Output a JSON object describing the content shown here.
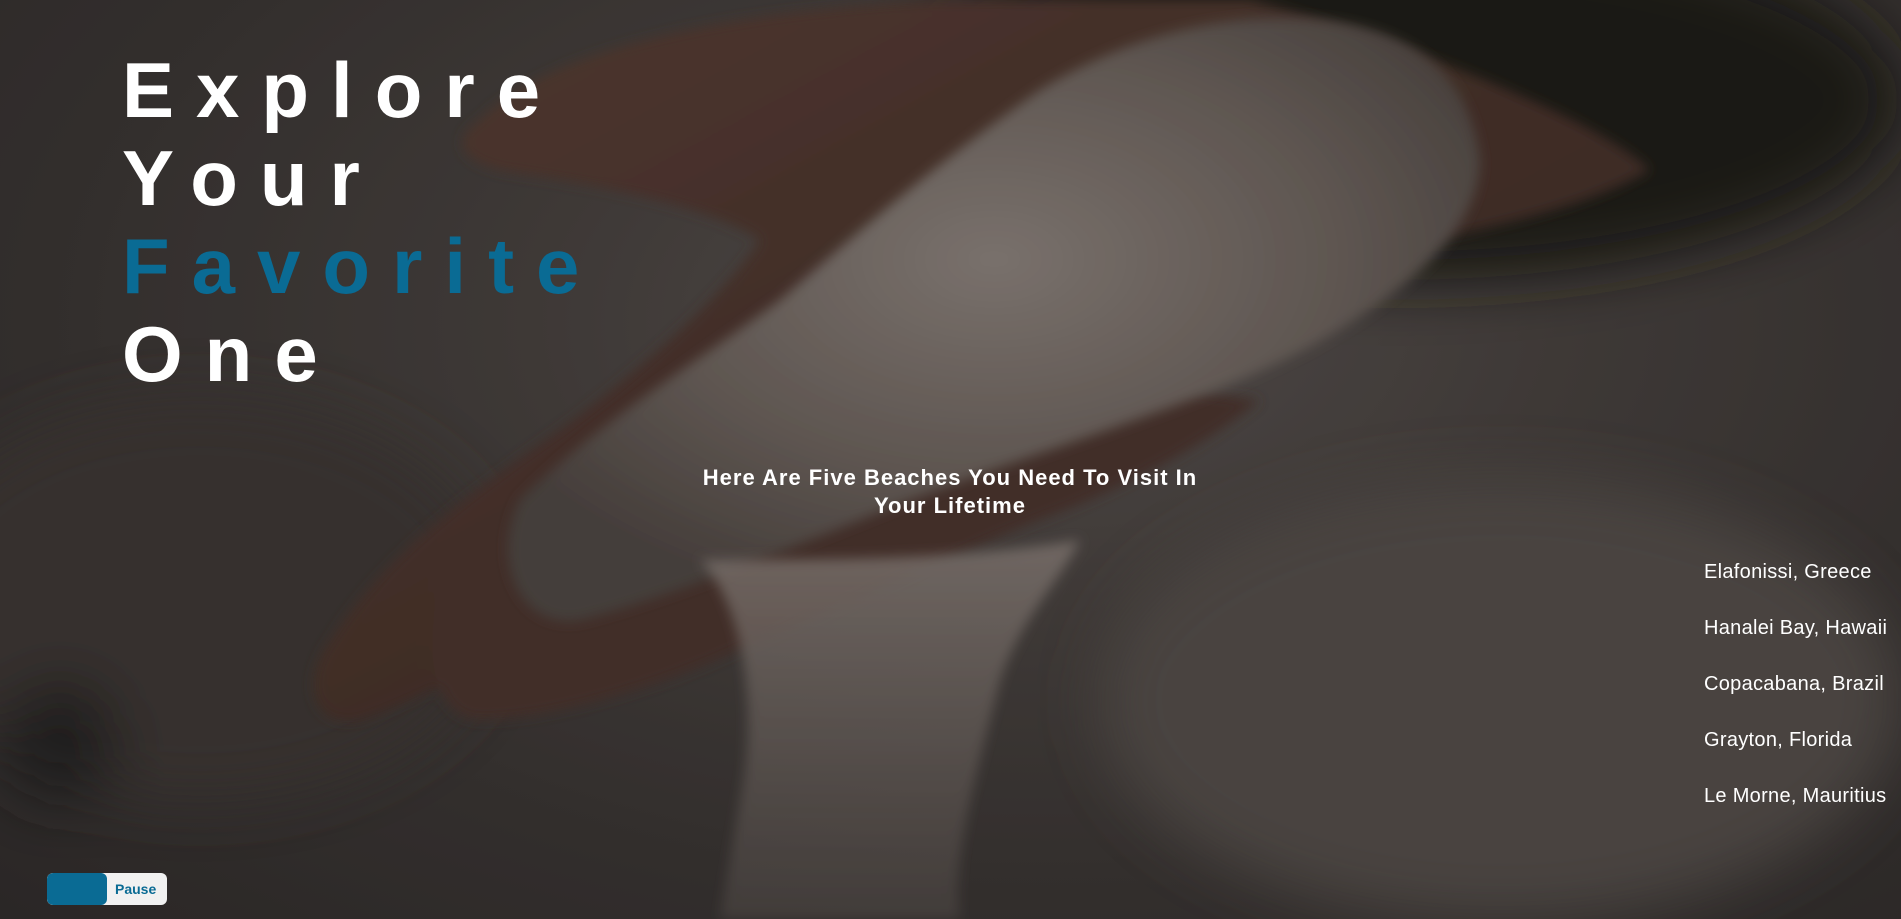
{
  "hero": {
    "headline_line1": "Explore",
    "headline_line2": "Your",
    "headline_line3": "Favorite",
    "headline_line4": "One",
    "subtitle": "Here Are Five Beaches You Need To Visit In Your Lifetime"
  },
  "beaches": [
    "Elafonissi, Greece",
    "Hanalei Bay, Hawaii",
    "Copacabana, Brazil",
    "Grayton, Florida",
    "Le Morne, Mauritius"
  ],
  "controls": {
    "pause_label": "Pause"
  },
  "colors": {
    "accent": "#0a6b94",
    "text": "#ffffff",
    "toggle_bg": "#f1f1f1"
  },
  "icons": {
    "background": "hand-with-sand-photo"
  }
}
